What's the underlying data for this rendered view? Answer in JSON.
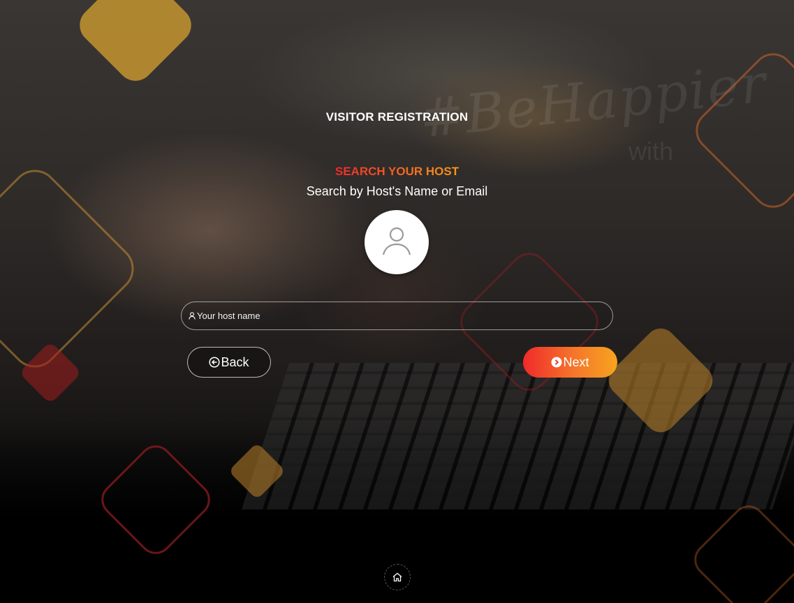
{
  "page": {
    "title": "VISITOR REGISTRATION",
    "watermark": "#BeHappier",
    "watermark_sub": "with"
  },
  "search": {
    "heading": "SEARCH YOUR HOST",
    "subheading": "Search by Host's Name or Email",
    "placeholder": "Your host name",
    "value": ""
  },
  "actions": {
    "back_label": "Back",
    "next_label": "Next"
  },
  "icons": {
    "avatar": "user-icon",
    "input": "user-icon",
    "back": "arrow-left-circle-icon",
    "next": "arrow-right-circle-icon",
    "home": "home-icon"
  },
  "colors": {
    "accent_start": "#ef2a2a",
    "accent_end": "#f7a41f",
    "background": "#000000"
  }
}
